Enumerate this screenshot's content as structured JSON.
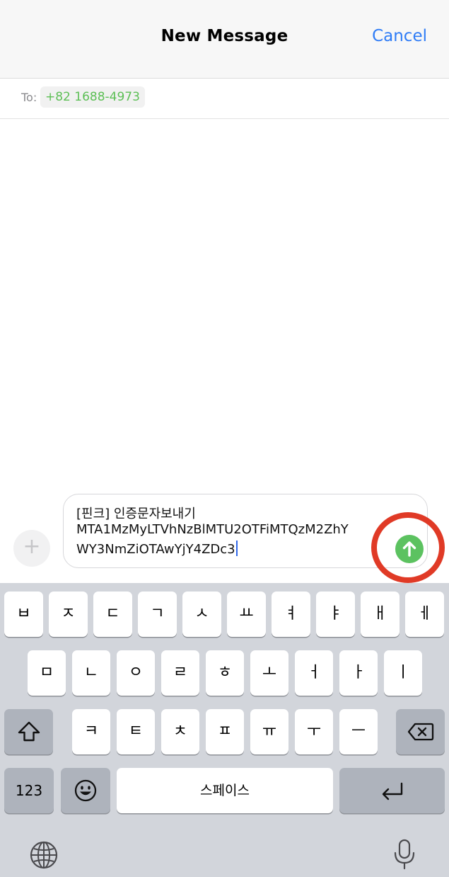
{
  "header": {
    "title": "New Message",
    "cancel_label": "Cancel"
  },
  "recipients": {
    "to_label": "To:",
    "number": "+82 1688-4973"
  },
  "compose": {
    "plus_label": "+",
    "message_lines": [
      "[핀크] 인증문자보내기",
      "MTA1MzMyLTVhNzBlMTU2OTFiMTQzM2ZhY",
      "WY3NmZiOTAwYjY4ZDc3"
    ]
  },
  "keyboard": {
    "row1": [
      "ㅂ",
      "ㅈ",
      "ㄷ",
      "ㄱ",
      "ㅅ",
      "ㅛ",
      "ㅕ",
      "ㅑ",
      "ㅐ",
      "ㅔ"
    ],
    "row2": [
      "ㅁ",
      "ㄴ",
      "ㅇ",
      "ㄹ",
      "ㅎ",
      "ㅗ",
      "ㅓ",
      "ㅏ",
      "ㅣ"
    ],
    "row3": [
      "ㅋ",
      "ㅌ",
      "ㅊ",
      "ㅍ",
      "ㅠ",
      "ㅜ",
      "ㅡ"
    ],
    "numbers_label": "123",
    "space_label": "스페이스",
    "icons": {
      "shift": "shift-icon",
      "delete": "delete-icon",
      "emoji": "emoji-icon",
      "return": "return-icon",
      "globe": "globe-icon",
      "mic": "microphone-icon"
    }
  },
  "colors": {
    "accent_blue": "#2f7cf6",
    "recipient_green": "#5cbf55",
    "send_green": "#5cc260",
    "highlight_red": "#e03a26"
  }
}
